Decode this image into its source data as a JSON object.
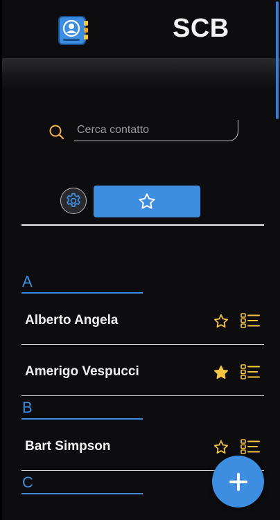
{
  "app": {
    "title": "SCB",
    "logo_icon": "contact-book-icon"
  },
  "search": {
    "placeholder": "Cerca contatto",
    "value": "",
    "icon": "search-icon"
  },
  "toolbar": {
    "settings_icon": "gear-icon",
    "favorites_icon": "star-outline-icon",
    "favorites_active": true
  },
  "sections": [
    {
      "letter": "A",
      "contacts": [
        {
          "name": "Alberto Angela",
          "favorite": false
        },
        {
          "name": "Amerigo Vespucci",
          "favorite": true
        }
      ]
    },
    {
      "letter": "B",
      "contacts": [
        {
          "name": "Bart Simpson",
          "favorite": false
        }
      ]
    },
    {
      "letter": "C",
      "contacts": []
    }
  ],
  "fab": {
    "icon": "plus-icon"
  },
  "colors": {
    "background": "#0d0d10",
    "accent": "#3d8de0",
    "star": "#f5c542",
    "details": "#f5c542",
    "search_icon": "#f2b04a"
  }
}
